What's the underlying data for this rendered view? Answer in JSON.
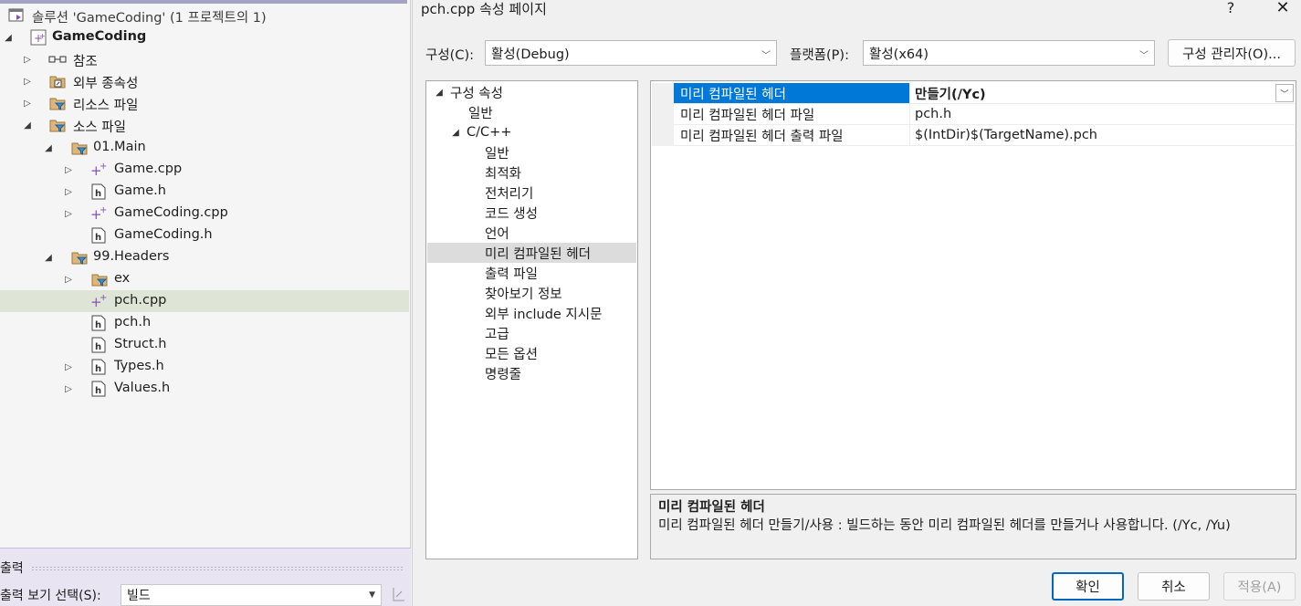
{
  "solution_explorer": {
    "rows": [
      {
        "label": "솔루션 'GameCoding' (1 프로젝트의 1)",
        "arrow": "",
        "icon": "solution-icon"
      },
      {
        "label": "GameCoding",
        "arrow": "◢",
        "icon": "cpp-project-icon",
        "bold": true
      },
      {
        "label": "참조",
        "arrow": "▷",
        "icon": "references-icon"
      },
      {
        "label": "외부 종속성",
        "arrow": "▷",
        "icon": "external-dependencies-icon"
      },
      {
        "label": "리소스 파일",
        "arrow": "▷",
        "icon": "filter-folder-icon"
      },
      {
        "label": "소스 파일",
        "arrow": "◢",
        "icon": "filter-folder-icon"
      },
      {
        "label": "01.Main",
        "arrow": "◢",
        "icon": "filter-folder-icon"
      },
      {
        "label": "Game.cpp",
        "arrow": "▷",
        "icon": "cpp-file-icon"
      },
      {
        "label": "Game.h",
        "arrow": "▷",
        "icon": "header-file-icon"
      },
      {
        "label": "GameCoding.cpp",
        "arrow": "▷",
        "icon": "cpp-file-icon"
      },
      {
        "label": "GameCoding.h",
        "arrow": "",
        "icon": "header-file-icon"
      },
      {
        "label": "99.Headers",
        "arrow": "◢",
        "icon": "filter-folder-icon"
      },
      {
        "label": "ex",
        "arrow": "▷",
        "icon": "filter-folder-icon"
      },
      {
        "label": "pch.cpp",
        "arrow": "",
        "icon": "cpp-file-icon"
      },
      {
        "label": "pch.h",
        "arrow": "",
        "icon": "header-file-icon"
      },
      {
        "label": "Struct.h",
        "arrow": "",
        "icon": "header-file-icon"
      },
      {
        "label": "Types.h",
        "arrow": "▷",
        "icon": "header-file-icon"
      },
      {
        "label": "Values.h",
        "arrow": "▷",
        "icon": "header-file-icon"
      }
    ]
  },
  "output": {
    "title": "출력",
    "source_label": "출력 보기 선택(S):",
    "source_value": "빌드"
  },
  "dialog": {
    "title": "pch.cpp 속성 페이지",
    "help": "?",
    "close": "✕",
    "config_label": "구성(C):",
    "config_value": "활성(Debug)",
    "platform_label": "플랫폼(P):",
    "platform_value": "활성(x64)",
    "config_manager": "구성 관리자(O)...",
    "nav": [
      {
        "label": "구성 속성",
        "arrow": "◢"
      },
      {
        "label": "일반",
        "arrow": ""
      },
      {
        "label": "C/C++",
        "arrow": "◢"
      },
      {
        "label": "일반",
        "arrow": ""
      },
      {
        "label": "최적화",
        "arrow": ""
      },
      {
        "label": "전처리기",
        "arrow": ""
      },
      {
        "label": "코드 생성",
        "arrow": ""
      },
      {
        "label": "언어",
        "arrow": ""
      },
      {
        "label": "미리 컴파일된 헤더",
        "arrow": ""
      },
      {
        "label": "출력 파일",
        "arrow": ""
      },
      {
        "label": "찾아보기 정보",
        "arrow": ""
      },
      {
        "label": "외부 include 지시문",
        "arrow": ""
      },
      {
        "label": "고급",
        "arrow": ""
      },
      {
        "label": "모든 옵션",
        "arrow": ""
      },
      {
        "label": "명령줄",
        "arrow": ""
      }
    ],
    "properties": [
      {
        "name": "미리 컴파일된 헤더",
        "value": "만들기(/Yc)"
      },
      {
        "name": "미리 컴파일된 헤더 파일",
        "value": "pch.h"
      },
      {
        "name": "미리 컴파일된 헤더 출력 파일",
        "value": "$(IntDir)$(TargetName).pch"
      }
    ],
    "description": {
      "title": "미리 컴파일된 헤더",
      "text": "미리 컴파일된 헤더 만들기/사용 : 빌드하는 동안 미리 컴파일된 헤더를 만들거나 사용합니다.     (/Yc, /Yu)"
    },
    "buttons": {
      "ok": "확인",
      "cancel": "취소",
      "apply": "적용(A)"
    }
  },
  "colors": {
    "selection_blue": "#0078d7",
    "tree_selected": "#dfe5d6",
    "output_panel": "#e8e4f2"
  }
}
